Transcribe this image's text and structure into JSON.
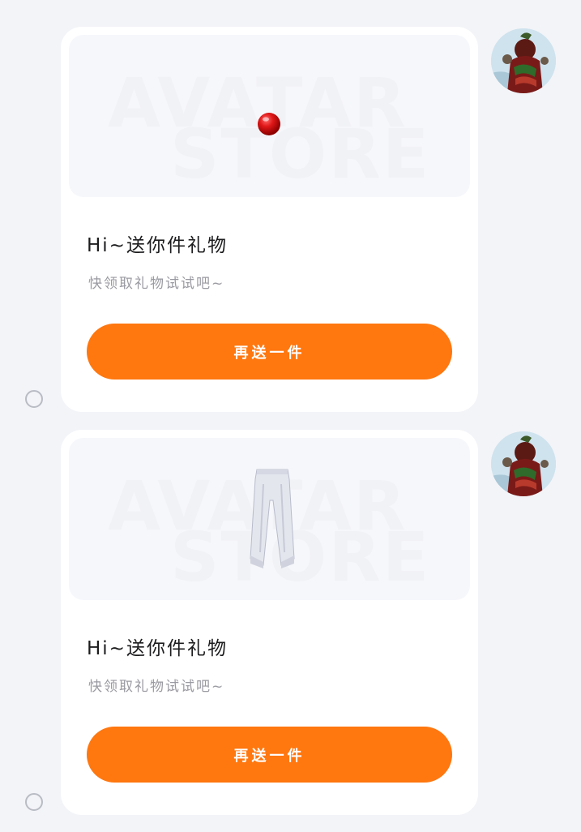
{
  "messages": [
    {
      "watermark_line1": "AVATAR",
      "watermark_line2": "STORE",
      "gift_icon": "red-ball-icon",
      "title": "Hi~送你件礼物",
      "subtitle": "快领取礼物试试吧~",
      "button_label": "再送一件"
    },
    {
      "watermark_line1": "AVATAR",
      "watermark_line2": "STORE",
      "gift_icon": "white-pants-icon",
      "title": "Hi~送你件礼物",
      "subtitle": "快领取礼物试试吧~",
      "button_label": "再送一件"
    }
  ],
  "colors": {
    "accent": "#ff770f",
    "background": "#f3f4f8",
    "card": "#ffffff"
  }
}
